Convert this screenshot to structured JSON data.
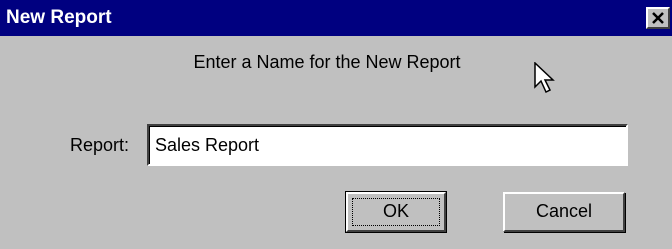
{
  "window": {
    "title": "New Report",
    "close_icon": "close-icon"
  },
  "dialog": {
    "prompt": "Enter a Name for the New Report",
    "report_label": "Report:",
    "report_value": "Sales Report"
  },
  "buttons": {
    "ok_label": "OK",
    "cancel_label": "Cancel"
  },
  "colors": {
    "titlebar": "#000080",
    "window_bg": "#c0c0c0"
  },
  "cursor_icon": "arrow-cursor-icon"
}
